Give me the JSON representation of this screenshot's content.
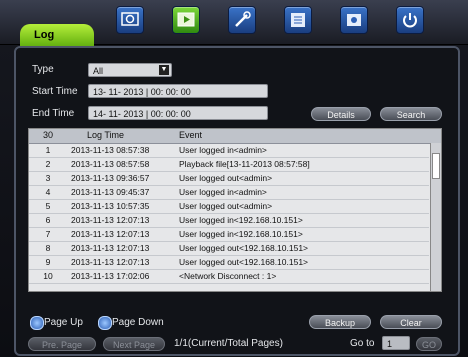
{
  "tabs": {
    "active": "Log"
  },
  "toolbar_icons": [
    "search-icon",
    "playback-icon",
    "tools-icon",
    "settings-icon",
    "backup-icon",
    "power-icon"
  ],
  "filter": {
    "type_label": "Type",
    "type_value": "All",
    "start_label": "Start Time",
    "start_value": "13- 11- 2013  |  00: 00: 00",
    "end_label": "End Time",
    "end_value": "14- 11- 2013  |  00: 00: 00",
    "details_button": "Details",
    "search_button": "Search"
  },
  "table": {
    "header_count": "30",
    "header_time": "Log Time",
    "header_event": "Event",
    "rows": [
      {
        "n": "1",
        "t": "2013-11-13 08:57:38",
        "e": "User logged in<admin>"
      },
      {
        "n": "2",
        "t": "2013-11-13 08:57:58",
        "e": "Playback file[13-11-2013 08:57:58]"
      },
      {
        "n": "3",
        "t": "2013-11-13 09:36:57",
        "e": "User logged out<admin>"
      },
      {
        "n": "4",
        "t": "2013-11-13 09:45:37",
        "e": "User logged in<admin>"
      },
      {
        "n": "5",
        "t": "2013-11-13 10:57:35",
        "e": "User logged out<admin>"
      },
      {
        "n": "6",
        "t": "2013-11-13 12:07:13",
        "e": "User logged in<192.168.10.151>"
      },
      {
        "n": "7",
        "t": "2013-11-13 12:07:13",
        "e": "User logged in<192.168.10.151>"
      },
      {
        "n": "8",
        "t": "2013-11-13 12:07:13",
        "e": "User logged out<192.168.10.151>"
      },
      {
        "n": "9",
        "t": "2013-11-13 12:07:13",
        "e": "User logged out<192.168.10.151>"
      },
      {
        "n": "10",
        "t": "2013-11-13 17:02:06",
        "e": "<Network Disconnect : 1>"
      }
    ]
  },
  "footer": {
    "page_up": "Page Up",
    "page_down": "Page Down",
    "backup_button": "Backup",
    "clear_button": "Clear",
    "pre_page": "Pre. Page",
    "next_page": "Next Page",
    "page_info": "1/1(Current/Total Pages)",
    "goto_label": "Go to",
    "goto_value": "1",
    "go_button": "GO"
  },
  "colors": {
    "accent_tab": "#8fd422",
    "icon_blue": "#2c5fb5"
  }
}
